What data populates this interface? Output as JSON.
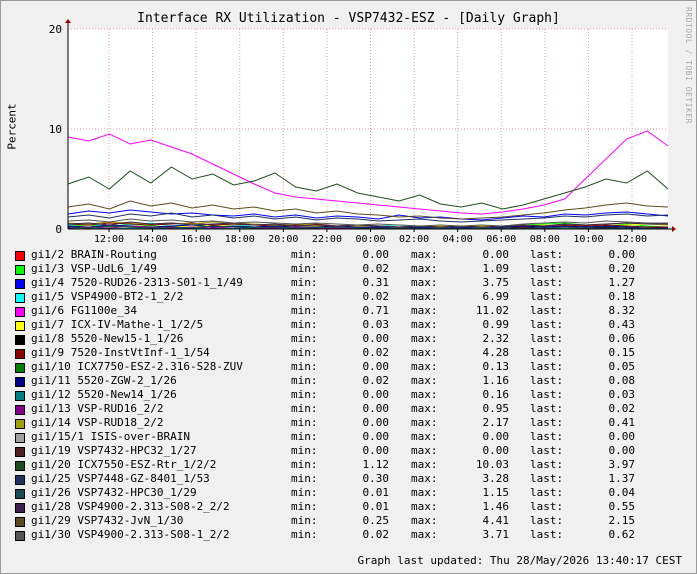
{
  "title": "Interface RX Utilization - VSP7432-ESZ - [Daily Graph]",
  "ylabel": "Percent",
  "credit": "RRDTOOL / TOBI OETIKER",
  "last_updated": "Graph last updated: Thu 28/May/2026 13:40:17 CEST",
  "labels": {
    "min": "min:",
    "max": "max:",
    "last": "last:"
  },
  "chart_data": {
    "type": "line",
    "title": "Interface RX Utilization - VSP7432-ESZ - [Daily Graph]",
    "xlabel": "",
    "ylabel": "Percent",
    "ylim": [
      0,
      20
    ],
    "yticks": [
      0,
      10,
      20
    ],
    "x_ticks": [
      "12:00",
      "14:00",
      "16:00",
      "18:00",
      "20:00",
      "22:00",
      "00:00",
      "02:00",
      "04:00",
      "06:00",
      "08:00",
      "10:00",
      "12:00"
    ],
    "grid": true,
    "series": [
      {
        "name": "gi1/2 BRAIN-Routing",
        "color": "#ff0000",
        "min": "0.00",
        "max": "0.00",
        "last": "0.00",
        "values": [
          0,
          0,
          0,
          0,
          0,
          0,
          0,
          0,
          0,
          0,
          0,
          0,
          0,
          0,
          0,
          0,
          0,
          0,
          0,
          0,
          0,
          0,
          0,
          0,
          0,
          0,
          0,
          0,
          0,
          0
        ]
      },
      {
        "name": "gi1/3 VSP-UdL6_1/49",
        "color": "#00ff00",
        "min": "0.02",
        "max": "1.09",
        "last": "0.20",
        "values": [
          0.3,
          0.4,
          0.2,
          0.5,
          0.3,
          0.6,
          0.4,
          0.3,
          0.5,
          0.2,
          0.3,
          0.4,
          0.3,
          0.2,
          0.4,
          0.3,
          0.2,
          0.3,
          0.1,
          0.2,
          0.3,
          0.2,
          0.4,
          0.5,
          0.6,
          0.4,
          0.3,
          0.5,
          0.3,
          0.2
        ]
      },
      {
        "name": "gi1/4 7520-RUD26-2313-S01-1_1/49",
        "color": "#0000ff",
        "min": "0.31",
        "max": "3.75",
        "last": "1.27",
        "values": [
          1.5,
          1.8,
          1.6,
          1.9,
          1.7,
          1.5,
          1.6,
          1.4,
          1.3,
          1.5,
          1.2,
          1.4,
          1.1,
          1.3,
          1.2,
          1.0,
          1.4,
          1.1,
          1.2,
          1.0,
          0.9,
          1.1,
          1.3,
          1.2,
          1.5,
          1.4,
          1.6,
          1.7,
          1.5,
          1.3
        ]
      },
      {
        "name": "gi1/5 VSP4900-BT2-1_2/2",
        "color": "#00ffff",
        "min": "0.02",
        "max": "6.99",
        "last": "0.18",
        "values": [
          0.4,
          0.5,
          0.3,
          0.4,
          0.6,
          0.3,
          0.5,
          0.4,
          0.3,
          0.4,
          0.3,
          0.5,
          0.4,
          0.3,
          0.2,
          0.3,
          0.4,
          0.3,
          0.2,
          0.3,
          0.2,
          0.3,
          0.2,
          0.3,
          0.4,
          0.3,
          0.2,
          0.3,
          0.2,
          0.2
        ]
      },
      {
        "name": "gi1/6 FG1100e_34",
        "color": "#ff00ff",
        "min": "0.71",
        "max": "11.02",
        "last": "8.32",
        "values": [
          9.2,
          8.8,
          9.5,
          8.5,
          8.9,
          8.2,
          7.5,
          6.5,
          5.5,
          4.5,
          3.6,
          3.2,
          3.0,
          2.8,
          2.6,
          2.4,
          2.2,
          2.0,
          1.8,
          1.6,
          1.5,
          1.7,
          2.0,
          2.4,
          3.0,
          5.0,
          7.0,
          9.0,
          9.8,
          8.3
        ]
      },
      {
        "name": "gi1/7 ICX-IV-Mathe-1_1/2/5",
        "color": "#ffff00",
        "min": "0.03",
        "max": "0.99",
        "last": "0.43",
        "values": [
          0.3,
          0.2,
          0.4,
          0.3,
          0.2,
          0.3,
          0.2,
          0.4,
          0.3,
          0.2,
          0.3,
          0.2,
          0.3,
          0.2,
          0.3,
          0.2,
          0.1,
          0.2,
          0.3,
          0.2,
          0.3,
          0.2,
          0.3,
          0.4,
          0.3,
          0.4,
          0.3,
          0.4,
          0.5,
          0.4
        ]
      },
      {
        "name": "gi1/8 5520-New15-1_1/26",
        "color": "#000000",
        "min": "0.00",
        "max": "2.32",
        "last": "0.06",
        "values": [
          0.2,
          0.1,
          0.3,
          0.2,
          0.1,
          0.2,
          0.1,
          0.3,
          0.2,
          0.1,
          0.2,
          0.1,
          0.1,
          0.2,
          0.1,
          0.1,
          0.1,
          0.2,
          0.1,
          0.1,
          0.1,
          0.1,
          0.2,
          0.1,
          0.2,
          0.1,
          0.2,
          0.1,
          0.1,
          0.1
        ]
      },
      {
        "name": "gi1/9 7520-InstVtInf-1_1/54",
        "color": "#8b0000",
        "min": "0.02",
        "max": "4.28",
        "last": "0.15",
        "values": [
          0.5,
          0.4,
          0.6,
          0.5,
          0.4,
          0.5,
          0.6,
          0.4,
          0.5,
          0.4,
          0.3,
          0.4,
          0.5,
          0.3,
          0.4,
          0.3,
          0.2,
          0.3,
          0.2,
          0.3,
          0.2,
          0.3,
          0.2,
          0.3,
          0.4,
          0.3,
          0.4,
          0.3,
          0.2,
          0.2
        ]
      },
      {
        "name": "gi1/10 ICX7750-ESZ-2.316-S28-ZUV",
        "color": "#008000",
        "min": "0.00",
        "max": "0.13",
        "last": "0.05",
        "values": [
          0.05,
          0.06,
          0.05,
          0.07,
          0.05,
          0.06,
          0.05,
          0.04,
          0.05,
          0.06,
          0.05,
          0.04,
          0.05,
          0.04,
          0.05,
          0.04,
          0.03,
          0.04,
          0.05,
          0.04,
          0.05,
          0.04,
          0.05,
          0.06,
          0.05,
          0.06,
          0.05,
          0.06,
          0.05,
          0.05
        ]
      },
      {
        "name": "gi1/11 5520-ZGW-2_1/26",
        "color": "#00008b",
        "min": "0.02",
        "max": "1.16",
        "last": "0.08",
        "values": [
          0.3,
          0.2,
          0.4,
          0.3,
          0.2,
          0.3,
          0.4,
          0.2,
          0.3,
          0.2,
          0.3,
          0.2,
          0.2,
          0.3,
          0.2,
          0.2,
          0.1,
          0.2,
          0.1,
          0.2,
          0.1,
          0.2,
          0.3,
          0.2,
          0.3,
          0.2,
          0.3,
          0.2,
          0.1,
          0.1
        ]
      },
      {
        "name": "gi1/12 5520-New14_1/26",
        "color": "#008080",
        "min": "0.00",
        "max": "0.16",
        "last": "0.03",
        "values": [
          0.05,
          0.04,
          0.06,
          0.05,
          0.04,
          0.05,
          0.04,
          0.06,
          0.05,
          0.04,
          0.03,
          0.04,
          0.05,
          0.03,
          0.04,
          0.03,
          0.02,
          0.03,
          0.02,
          0.03,
          0.02,
          0.03,
          0.04,
          0.03,
          0.04,
          0.03,
          0.04,
          0.03,
          0.03,
          0.03
        ]
      },
      {
        "name": "gi1/13 VSP-RUD16_2/2",
        "color": "#8b008b",
        "min": "0.00",
        "max": "0.95",
        "last": "0.02",
        "values": [
          0.1,
          0.2,
          0.1,
          0.3,
          0.2,
          0.1,
          0.2,
          0.1,
          0.2,
          0.1,
          0.1,
          0.2,
          0.1,
          0.1,
          0.1,
          0.1,
          0.0,
          0.1,
          0.0,
          0.1,
          0.0,
          0.1,
          0.1,
          0.1,
          0.2,
          0.1,
          0.1,
          0.1,
          0.0,
          0.0
        ]
      },
      {
        "name": "gi1/14 VSP-RUD18_2/2",
        "color": "#a0a000",
        "min": "0.00",
        "max": "2.17",
        "last": "0.41",
        "values": [
          0.6,
          0.5,
          0.7,
          0.6,
          0.5,
          0.6,
          0.5,
          0.7,
          0.6,
          0.5,
          0.4,
          0.5,
          0.4,
          0.3,
          0.4,
          0.3,
          0.2,
          0.3,
          0.2,
          0.3,
          0.2,
          0.3,
          0.4,
          0.3,
          0.5,
          0.4,
          0.5,
          0.6,
          0.5,
          0.4
        ]
      },
      {
        "name": "gi1/15/1 ISIS-over-BRAIN",
        "color": "#a0a0a0",
        "min": "0.00",
        "max": "0.00",
        "last": "0.00",
        "values": [
          0,
          0,
          0,
          0,
          0,
          0,
          0,
          0,
          0,
          0,
          0,
          0,
          0,
          0,
          0,
          0,
          0,
          0,
          0,
          0,
          0,
          0,
          0,
          0,
          0,
          0,
          0,
          0,
          0,
          0
        ]
      },
      {
        "name": "gi1/19 VSP7432-HPC32_1/27",
        "color": "#502020",
        "min": "0.00",
        "max": "0.00",
        "last": "0.00",
        "values": [
          0,
          0,
          0,
          0,
          0,
          0,
          0,
          0,
          0,
          0,
          0,
          0,
          0,
          0,
          0,
          0,
          0,
          0,
          0,
          0,
          0,
          0,
          0,
          0,
          0,
          0,
          0,
          0,
          0,
          0
        ]
      },
      {
        "name": "gi1/20 ICX7550-ESZ-Rtr_1/2/2",
        "color": "#1e4d1e",
        "min": "1.12",
        "max": "10.03",
        "last": "3.97",
        "values": [
          4.5,
          5.2,
          4.0,
          5.8,
          4.6,
          6.2,
          5.0,
          5.5,
          4.4,
          4.8,
          5.6,
          4.2,
          3.8,
          4.5,
          3.6,
          3.2,
          2.8,
          3.4,
          2.5,
          2.2,
          2.6,
          2.0,
          2.4,
          3.0,
          3.6,
          4.2,
          5.0,
          4.6,
          5.8,
          4.0
        ]
      },
      {
        "name": "gi1/25 VSP7448-GZ-8401_1/53",
        "color": "#203060",
        "min": "0.30",
        "max": "3.28",
        "last": "1.37",
        "values": [
          1.2,
          1.4,
          1.1,
          1.5,
          1.3,
          1.6,
          1.2,
          1.4,
          1.1,
          1.3,
          1.0,
          1.2,
          0.9,
          1.1,
          1.0,
          0.8,
          0.9,
          1.0,
          0.8,
          0.7,
          0.8,
          0.9,
          1.0,
          1.1,
          1.3,
          1.2,
          1.4,
          1.5,
          1.3,
          1.4
        ]
      },
      {
        "name": "gi1/26 VSP7432-HPC30_1/29",
        "color": "#1c4a5a",
        "min": "0.01",
        "max": "1.15",
        "last": "0.04",
        "values": [
          0.2,
          0.1,
          0.3,
          0.2,
          0.1,
          0.2,
          0.1,
          0.3,
          0.2,
          0.1,
          0.2,
          0.1,
          0.1,
          0.2,
          0.1,
          0.1,
          0.1,
          0.1,
          0.1,
          0.1,
          0.1,
          0.1,
          0.1,
          0.1,
          0.2,
          0.1,
          0.1,
          0.1,
          0.1,
          0.0
        ]
      },
      {
        "name": "gi1/28 VSP4900-2.313-S08-2_2/2",
        "color": "#3d2050",
        "min": "0.01",
        "max": "1.46",
        "last": "0.55",
        "values": [
          0.5,
          0.6,
          0.4,
          0.7,
          0.5,
          0.6,
          0.4,
          0.5,
          0.6,
          0.4,
          0.5,
          0.3,
          0.4,
          0.3,
          0.4,
          0.3,
          0.2,
          0.3,
          0.2,
          0.3,
          0.2,
          0.3,
          0.4,
          0.3,
          0.5,
          0.4,
          0.5,
          0.6,
          0.5,
          0.5
        ]
      },
      {
        "name": "gi1/29 VSP7432-JvN_1/30",
        "color": "#5a4a1e",
        "min": "0.25",
        "max": "4.41",
        "last": "2.15",
        "values": [
          2.2,
          2.5,
          2.0,
          2.8,
          2.3,
          2.6,
          2.1,
          2.4,
          2.0,
          2.2,
          1.8,
          2.0,
          1.6,
          1.8,
          1.5,
          1.4,
          1.2,
          1.3,
          1.1,
          1.0,
          1.1,
          1.2,
          1.4,
          1.6,
          1.9,
          2.1,
          2.4,
          2.6,
          2.3,
          2.2
        ]
      },
      {
        "name": "gi1/30 VSP4900-2.313-S08-1_2/2",
        "color": "#555555",
        "min": "0.02",
        "max": "3.71",
        "last": "0.62",
        "values": [
          0.8,
          0.9,
          0.7,
          1.0,
          0.8,
          0.9,
          0.7,
          0.8,
          0.6,
          0.7,
          0.6,
          0.5,
          0.6,
          0.5,
          0.4,
          0.5,
          0.4,
          0.3,
          0.4,
          0.3,
          0.4,
          0.3,
          0.5,
          0.6,
          0.7,
          0.6,
          0.8,
          0.7,
          0.6,
          0.6
        ]
      }
    ]
  }
}
